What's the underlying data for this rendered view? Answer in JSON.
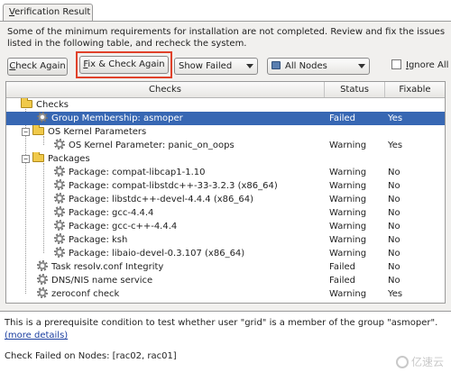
{
  "tab": {
    "label_mnemonic": "V",
    "label_rest": "erification Result"
  },
  "instructions": "Some of the minimum requirements for installation are not completed. Review and fix the issues listed in the following table, and recheck the system.",
  "toolbar": {
    "check_again": {
      "mnemonic": "C",
      "rest": "heck Again"
    },
    "fix_check_again": {
      "mnemonic": "F",
      "rest": "ix & Check Again"
    },
    "show_filter": "Show Failed",
    "nodes_filter": "All Nodes",
    "ignore_all": {
      "mnemonic": "I",
      "rest": "gnore All"
    }
  },
  "table": {
    "columns": {
      "checks": "Checks",
      "status": "Status",
      "fixable": "Fixable"
    },
    "rows": [
      {
        "label": "Checks",
        "status": "",
        "fixable": ""
      },
      {
        "label": "Group Membership: asmoper",
        "status": "Failed",
        "fixable": "Yes"
      },
      {
        "label": "OS Kernel Parameters",
        "status": "",
        "fixable": ""
      },
      {
        "label": "OS Kernel Parameter: panic_on_oops",
        "status": "Warning",
        "fixable": "Yes"
      },
      {
        "label": "Packages",
        "status": "",
        "fixable": ""
      },
      {
        "label": "Package: compat-libcap1-1.10",
        "status": "Warning",
        "fixable": "No"
      },
      {
        "label": "Package: compat-libstdc++-33-3.2.3 (x86_64)",
        "status": "Warning",
        "fixable": "No"
      },
      {
        "label": "Package: libstdc++-devel-4.4.4 (x86_64)",
        "status": "Warning",
        "fixable": "No"
      },
      {
        "label": "Package: gcc-4.4.4",
        "status": "Warning",
        "fixable": "No"
      },
      {
        "label": "Package: gcc-c++-4.4.4",
        "status": "Warning",
        "fixable": "No"
      },
      {
        "label": "Package: ksh",
        "status": "Warning",
        "fixable": "No"
      },
      {
        "label": "Package: libaio-devel-0.3.107 (x86_64)",
        "status": "Warning",
        "fixable": "No"
      },
      {
        "label": "Task resolv.conf Integrity",
        "status": "Failed",
        "fixable": "No"
      },
      {
        "label": "DNS/NIS name service",
        "status": "Failed",
        "fixable": "No"
      },
      {
        "label": "zeroconf check",
        "status": "Warning",
        "fixable": "Yes"
      }
    ]
  },
  "details": {
    "text": "This is a prerequisite condition to test whether user \"grid\" is a member of the group \"asmoper\".",
    "more_link": "(more details)",
    "failed_nodes": "Check Failed on Nodes: [rac02, rac01]"
  },
  "watermark": "亿速云"
}
